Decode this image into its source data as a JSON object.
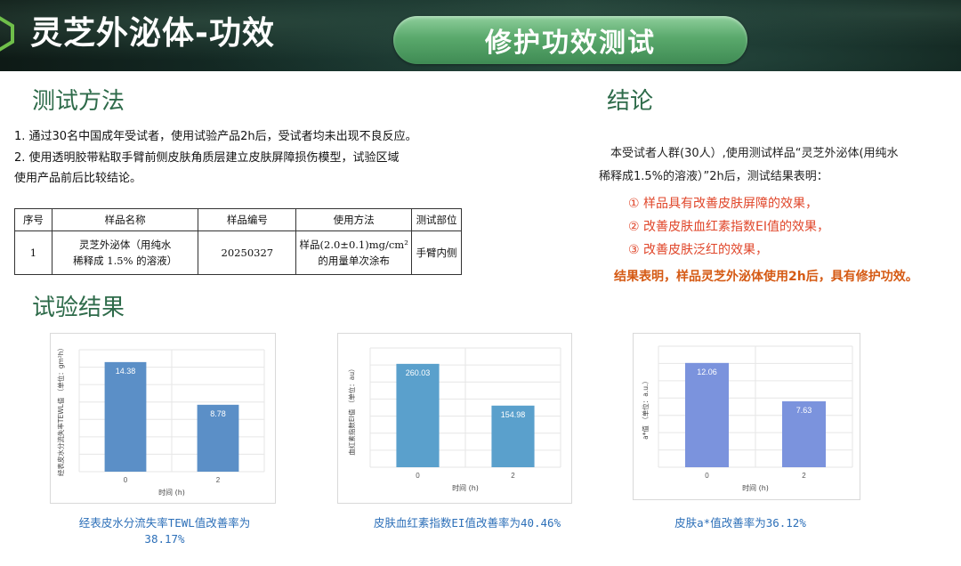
{
  "header": {
    "title": "灵芝外泌体-功效",
    "badge": "修护功效测试"
  },
  "method": {
    "title": "测试方法",
    "lines": [
      "1.  通过30名中国成年受试者，使用试验产品2h后，受试者均未出现不良反应。",
      "2.  使用透明胶带粘取手臂前侧皮肤角质层建立皮肤屏障损伤模型，试验区域",
      "使用产品前后比较结论。"
    ]
  },
  "table": {
    "headers": [
      "序号",
      "样品名称",
      "样品编号",
      "使用方法",
      "测试部位"
    ],
    "row": {
      "no": "1",
      "name_1": "灵芝外泌体（用纯水",
      "name_2": "稀释成 1.5% 的溶液）",
      "code": "20250327",
      "method_1": "样品(2.0±0.1)mg/cm²",
      "method_2": "的用量单次涂布",
      "site": "手臂内侧"
    }
  },
  "conclusion": {
    "title": "结论",
    "line1": "本受试者人群(30人）,使用测试样品“灵芝外泌体(用纯水",
    "line2": "稀释成1.5%的溶液）”2h后，测试结果表明：",
    "items": [
      "①  样品具有改善皮肤屏障的效果，",
      "②  改善皮肤血红素指数EI值的效果，",
      "③  改善皮肤泛红的效果，"
    ],
    "summary": "结果表明，样品灵芝外泌体使用2h后，具有修护功效。"
  },
  "results": {
    "title": "试验结果"
  },
  "colors": {
    "bar1": "#5b8fc7",
    "bar2": "#5aa0cc",
    "bar3": "#7b93dd",
    "caption": "#2c6fb8",
    "heading": "#2e6b4a"
  },
  "chart_data": [
    {
      "type": "bar",
      "categories": [
        "0",
        "2"
      ],
      "values": [
        14.38,
        8.78
      ],
      "xlabel": "时间 (h)",
      "ylabel": "经表皮水分流失率TEWL值 （单位：gm²h）",
      "ylim": [
        0,
        16
      ],
      "caption_1": "经表皮水分流失率TEWL值改善率为",
      "caption_2": "38.17%"
    },
    {
      "type": "bar",
      "categories": [
        "0",
        "2"
      ],
      "values": [
        260.03,
        154.98
      ],
      "xlabel": "时间 (h)",
      "ylabel": "血红素指数EI值 （单位：au）",
      "ylim": [
        0,
        300
      ],
      "caption_1": "皮肤血红素指数EI值改善率为40.46%"
    },
    {
      "type": "bar",
      "categories": [
        "0",
        "2"
      ],
      "values": [
        12.06,
        7.63
      ],
      "xlabel": "时间 (h)",
      "ylabel": "a*值 （单位：a.u.）",
      "ylim": [
        0,
        14
      ],
      "caption_1": "皮肤a*值改善率为36.12%"
    }
  ]
}
